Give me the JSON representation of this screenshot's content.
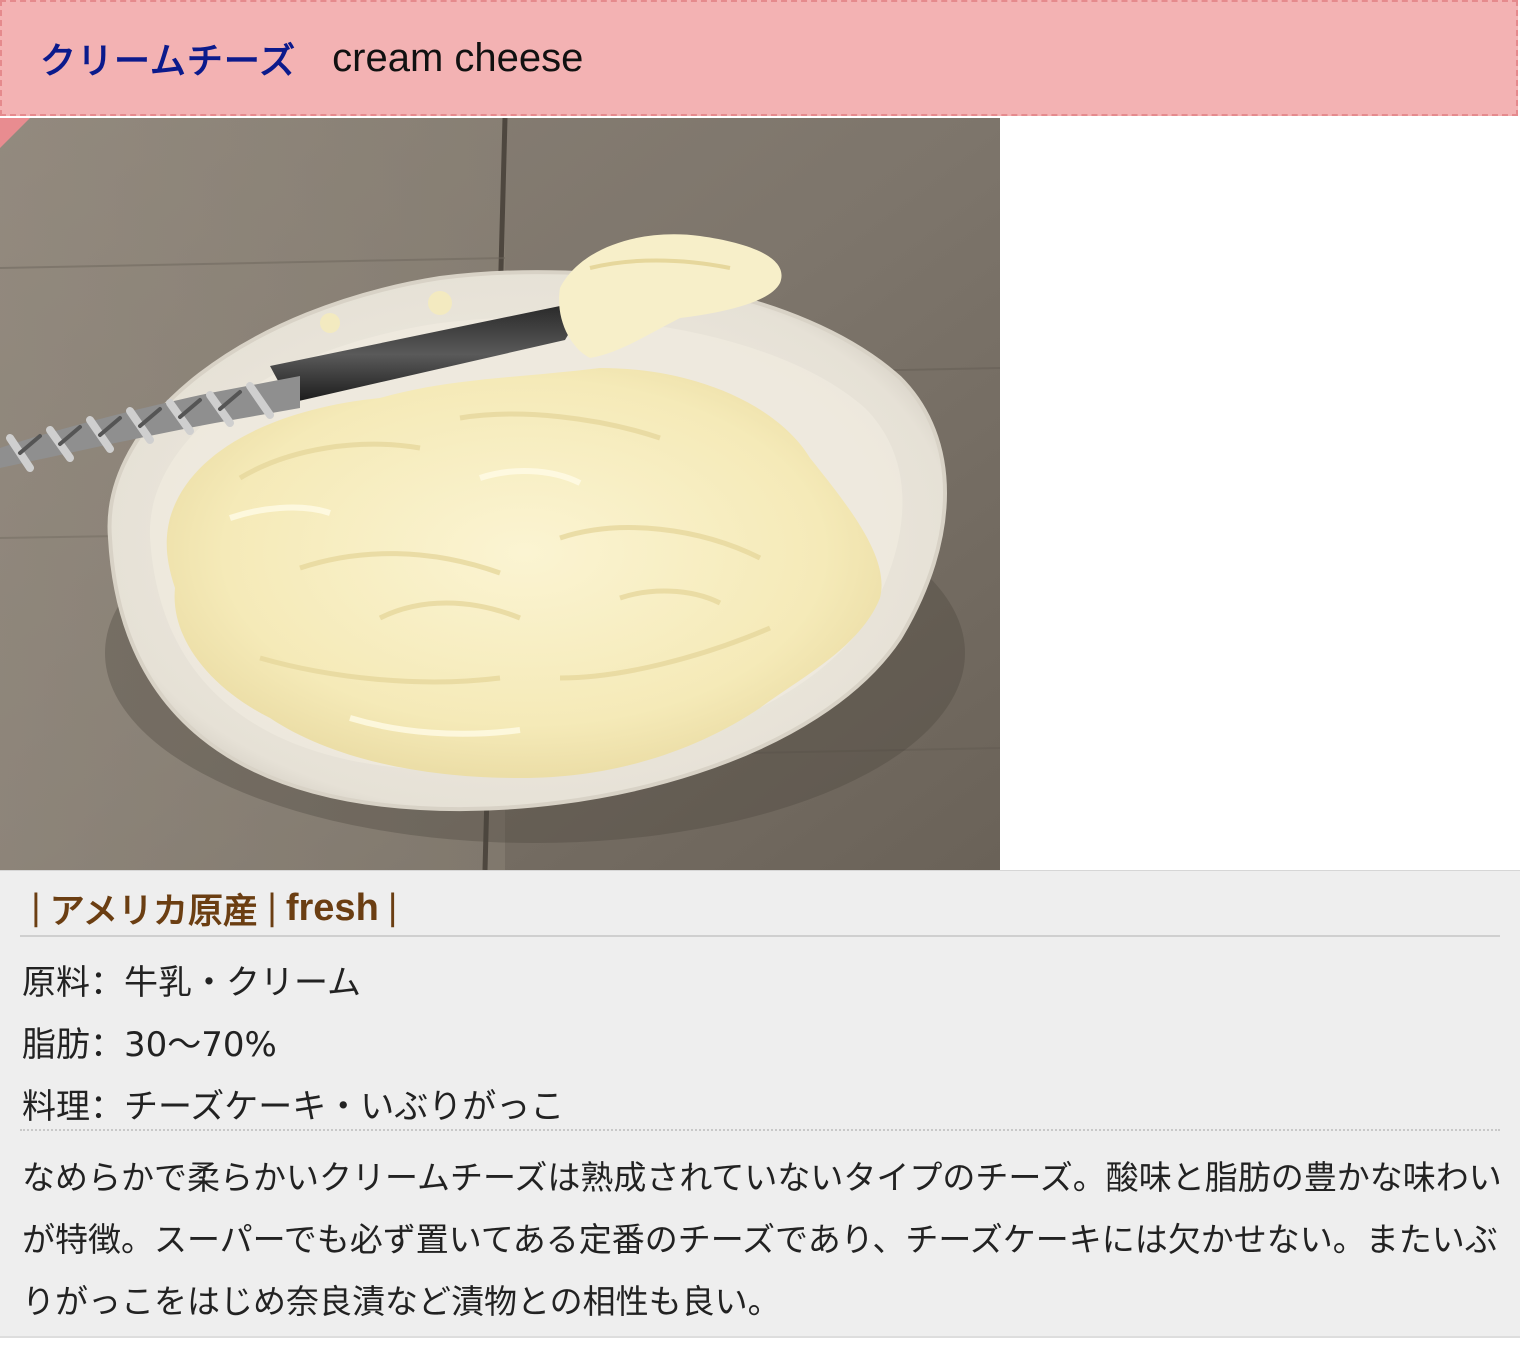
{
  "title": {
    "ja": "クリームチーズ",
    "en": "cream cheese"
  },
  "photo": {
    "icon": "cream-cheese-photo"
  },
  "tags": {
    "separator": "|",
    "origin": "アメリカ原産",
    "type": "fresh"
  },
  "specs": {
    "ingredients": "原料：牛乳・クリーム",
    "fat": "脂肪：30〜70%",
    "dishes": "料理：チーズケーキ・いぶりがっこ"
  },
  "description": "なめらかで柔らかいクリームチーズは熟成されていないタイプのチーズ。酸味と脂肪の豊かな味わいが特徴。スーパーでも必ず置いてある定番のチーズであり、チーズケーキには欠かせない。またいぶりがっこをはじめ奈良漬など漬物との相性も良い。",
  "colors": {
    "banner": "#f3b2b3",
    "title_ja": "#0b1a8c",
    "tag_text": "#6b3e12",
    "panel": "#eeeeee"
  }
}
